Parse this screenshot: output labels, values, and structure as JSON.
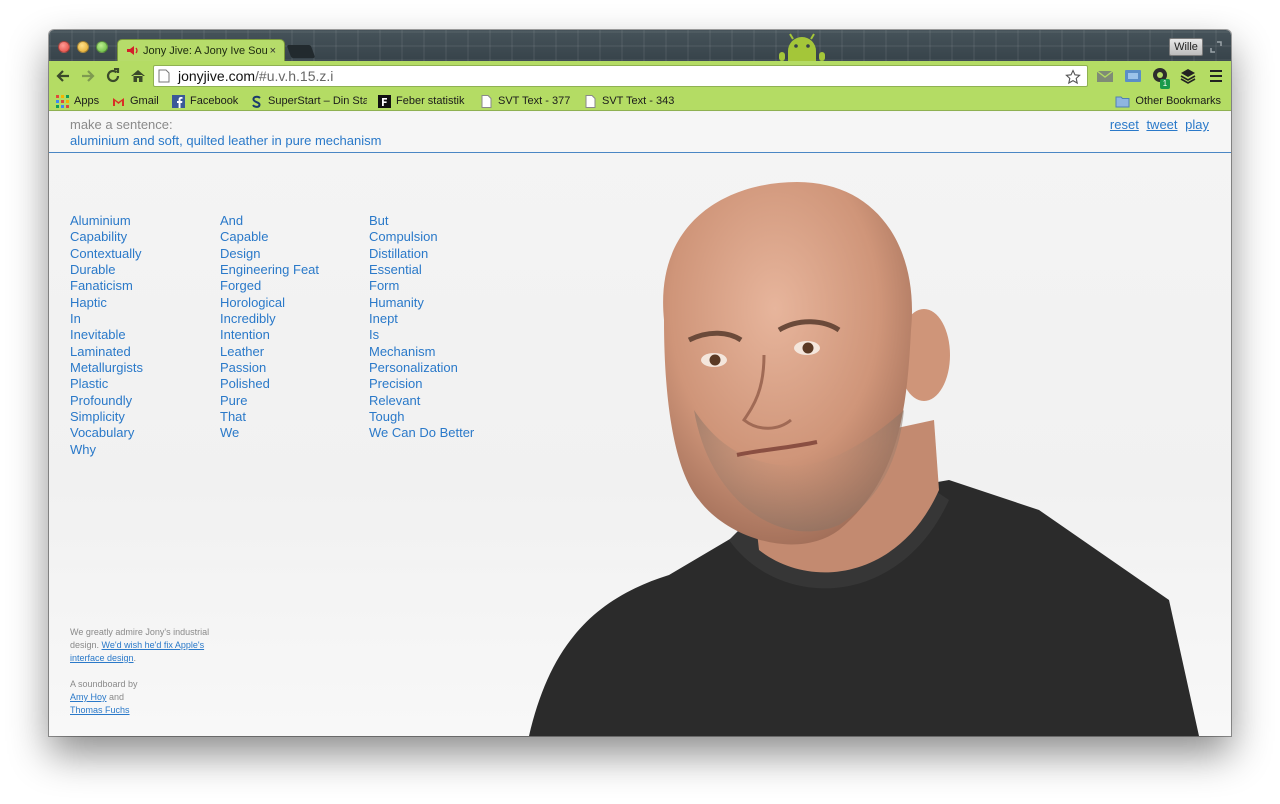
{
  "browser": {
    "tab_title": "Jony Jive: A Jony Ive Soundboard",
    "tab_close": "×",
    "user_name": "Wille",
    "url_host": "jonyjive.com",
    "url_path": "/#u.v.h.15.z.i",
    "extension_badge": "1",
    "accent_color": "#b4dc64"
  },
  "bookmarks": [
    {
      "label": "Apps",
      "icon": "apps-icon"
    },
    {
      "label": "Gmail",
      "icon": "gmail-icon"
    },
    {
      "label": "Facebook",
      "icon": "facebook-icon"
    },
    {
      "label": "SuperStart – Din Sta",
      "icon": "superstart-icon"
    },
    {
      "label": "Feber statistik",
      "icon": "feber-icon"
    },
    {
      "label": "SVT Text - 377",
      "icon": "page-icon"
    },
    {
      "label": "SVT Text - 343",
      "icon": "page-icon"
    }
  ],
  "other_bookmarks": "Other Bookmarks",
  "page": {
    "prompt_label": "make a sentence:",
    "sentence": "aluminium and soft, quilted leather in pure mechanism",
    "actions": {
      "reset": "reset",
      "tweet": "tweet",
      "play": "play"
    },
    "link_color": "#2a79c9",
    "words_col1": [
      "Aluminium",
      "Capability",
      "Contextually",
      "Durable",
      "Fanaticism",
      "Haptic",
      "In",
      "Inevitable",
      "Laminated",
      "Metallurgists",
      "Plastic",
      "Profoundly",
      "Simplicity",
      "Vocabulary",
      "Why"
    ],
    "words_col2": [
      "And",
      "Capable",
      "Design",
      "Engineering Feat",
      "Forged",
      "Horological",
      "Incredibly",
      "Intention",
      "Leather",
      "Passion",
      "Polished",
      "Pure",
      "That",
      "We"
    ],
    "words_col3": [
      "But",
      "Compulsion",
      "Distillation",
      "Essential",
      "Form",
      "Humanity",
      "Inept",
      "Is",
      "Mechanism",
      "Personalization",
      "Precision",
      "Relevant",
      "Tough",
      "We Can Do Better"
    ],
    "footer": {
      "admire_text": "We greatly admire Jony's industrial design.",
      "admire_link": "We'd wish he'd fix Apple's interface design",
      "admire_end": ".",
      "credit_prefix": "A soundboard by",
      "author1": "Amy Hoy",
      "and": "and",
      "author2": "Thomas Fuchs"
    }
  }
}
